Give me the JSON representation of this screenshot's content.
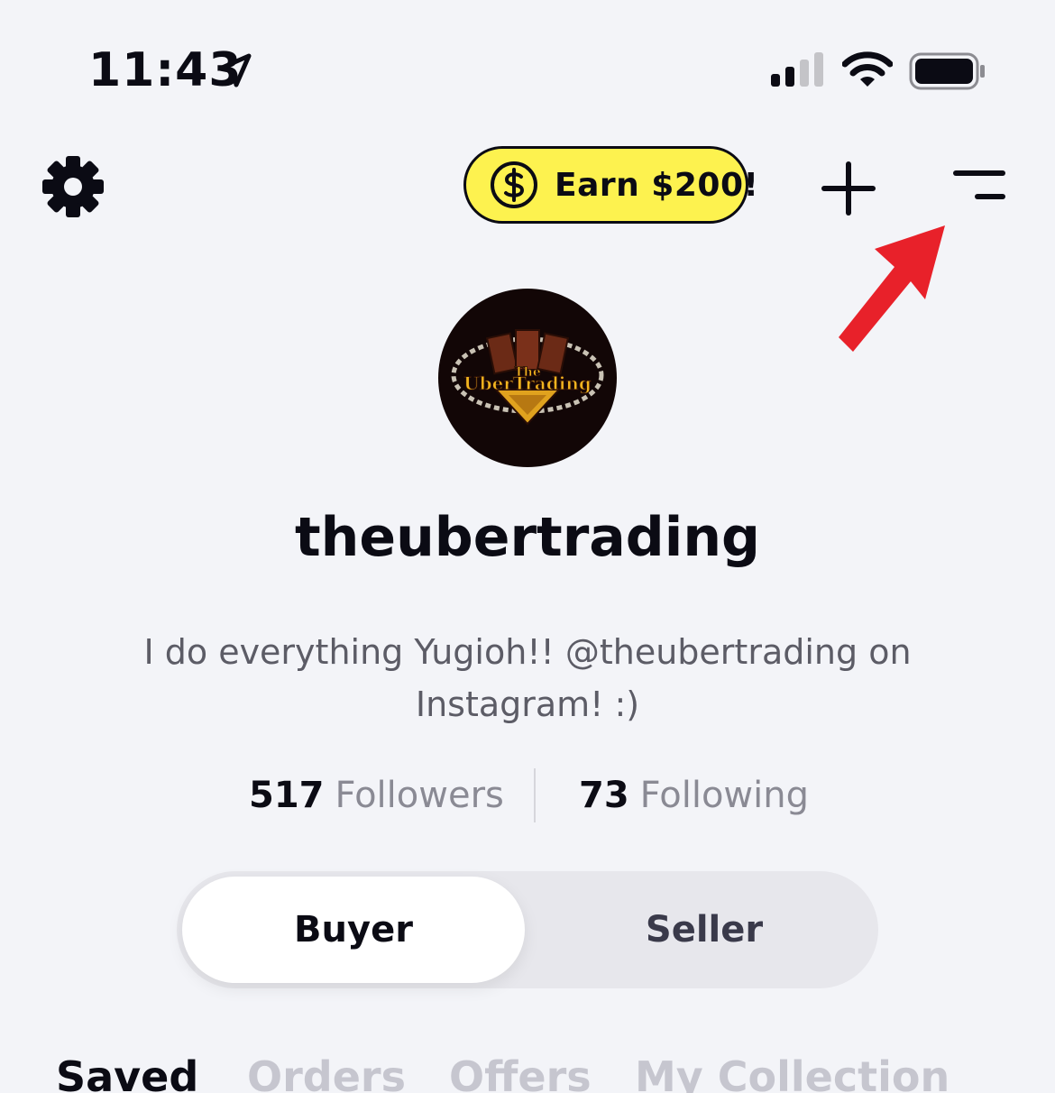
{
  "status_bar": {
    "time": "11:43",
    "location_icon": "location-arrow-icon",
    "signal_icon": "cellular-signal-icon",
    "wifi_icon": "wifi-icon",
    "battery_icon": "battery-icon"
  },
  "header": {
    "settings_icon": "gear-icon",
    "earn_label": "Earn $200!",
    "earn_icon": "dollar-coin-icon",
    "add_icon": "plus-icon",
    "menu_icon": "menu-icon",
    "accent_color": "#fdf24f",
    "annotation_color": "#e8212a"
  },
  "profile": {
    "avatar_text": {
      "the": "The",
      "name": "UberTrading"
    },
    "username": "theubertrading",
    "bio": "I do everything Yugioh!! @theubertrading on Instagram! :)",
    "followers_count": "517",
    "followers_label": "Followers",
    "following_count": "73",
    "following_label": "Following"
  },
  "mode_toggle": {
    "buyer_label": "Buyer",
    "seller_label": "Seller",
    "selected": "Buyer"
  },
  "tabs": [
    {
      "label": "Saved",
      "active": true
    },
    {
      "label": "Orders",
      "active": false
    },
    {
      "label": "Offers",
      "active": false
    },
    {
      "label": "My Collection",
      "active": false
    }
  ]
}
